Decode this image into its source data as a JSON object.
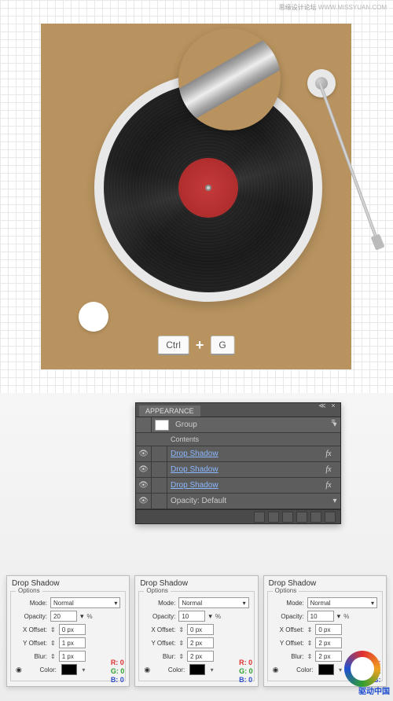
{
  "header": {
    "cn": "思缘设计论坛",
    "url": "WWW.MISSYUAN.COM"
  },
  "shortcut": {
    "key1": "Ctrl",
    "plus": "+",
    "key2": "G"
  },
  "panel": {
    "tab": "APPEARANCE",
    "group": "Group",
    "contents": "Contents",
    "rows": [
      {
        "label": "Drop Shadow",
        "link": true,
        "fx": "fx"
      },
      {
        "label": "Drop Shadow",
        "link": true,
        "fx": "fx"
      },
      {
        "label": "Drop Shadow",
        "link": true,
        "fx": "fx"
      }
    ],
    "opacity_label": "Opacity:",
    "opacity_value": "Default"
  },
  "dialogs": [
    {
      "title": "Drop Shadow",
      "options": "Options",
      "mode": "Normal",
      "opacity": "20",
      "xoff": "0 px",
      "yoff": "1 px",
      "blur": "1 px",
      "color": "Color:",
      "rgb": {
        "r": "R: 0",
        "g": "G: 0",
        "b": "B: 0"
      }
    },
    {
      "title": "Drop Shadow",
      "options": "Options",
      "mode": "Normal",
      "opacity": "10",
      "xoff": "0 px",
      "yoff": "2 px",
      "blur": "2 px",
      "color": "Color:",
      "rgb": {
        "r": "R: 0",
        "g": "G: 0",
        "b": "B: 0"
      }
    },
    {
      "title": "Drop Shadow",
      "options": "Options",
      "mode": "Normal",
      "opacity": "10",
      "xoff": "0 px",
      "yoff": "2 px",
      "blur": "2 px",
      "color": "Color:",
      "rgb": {
        "r": "R:",
        "g": "G:",
        "b": "B:"
      }
    }
  ],
  "labels": {
    "mode": "Mode:",
    "opacity": "Opacity:",
    "xoff": "X Offset:",
    "yoff": "Y Offset:",
    "blur": "Blur:",
    "pct": "%"
  },
  "logo": {
    "text": "驱动中国"
  }
}
